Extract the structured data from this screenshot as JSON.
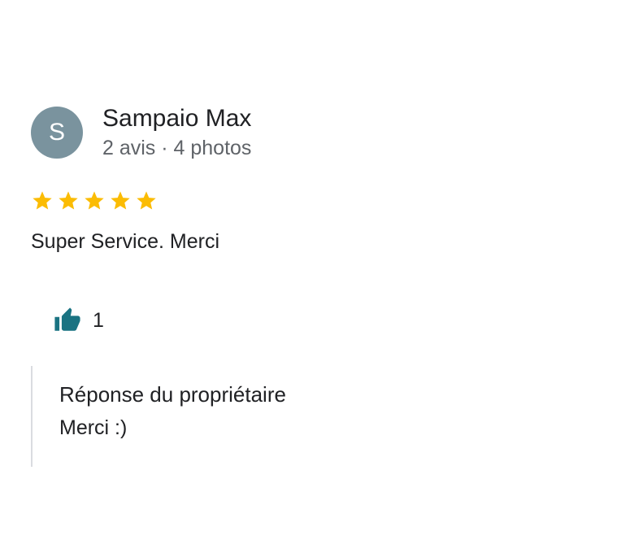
{
  "review": {
    "author": {
      "initial": "S",
      "name": "Sampaio Max",
      "meta": "2 avis · 4 photos",
      "avatar_color": "#7a939e"
    },
    "rating": {
      "stars": 5,
      "max": 5,
      "star_color": "#fbbc04"
    },
    "text": "Super Service. Merci",
    "like": {
      "icon": "thumbs-up-icon",
      "icon_color": "#1a7382",
      "count": "1"
    },
    "owner_reply": {
      "title": "Réponse du propriétaire",
      "text": "Merci :)"
    }
  }
}
